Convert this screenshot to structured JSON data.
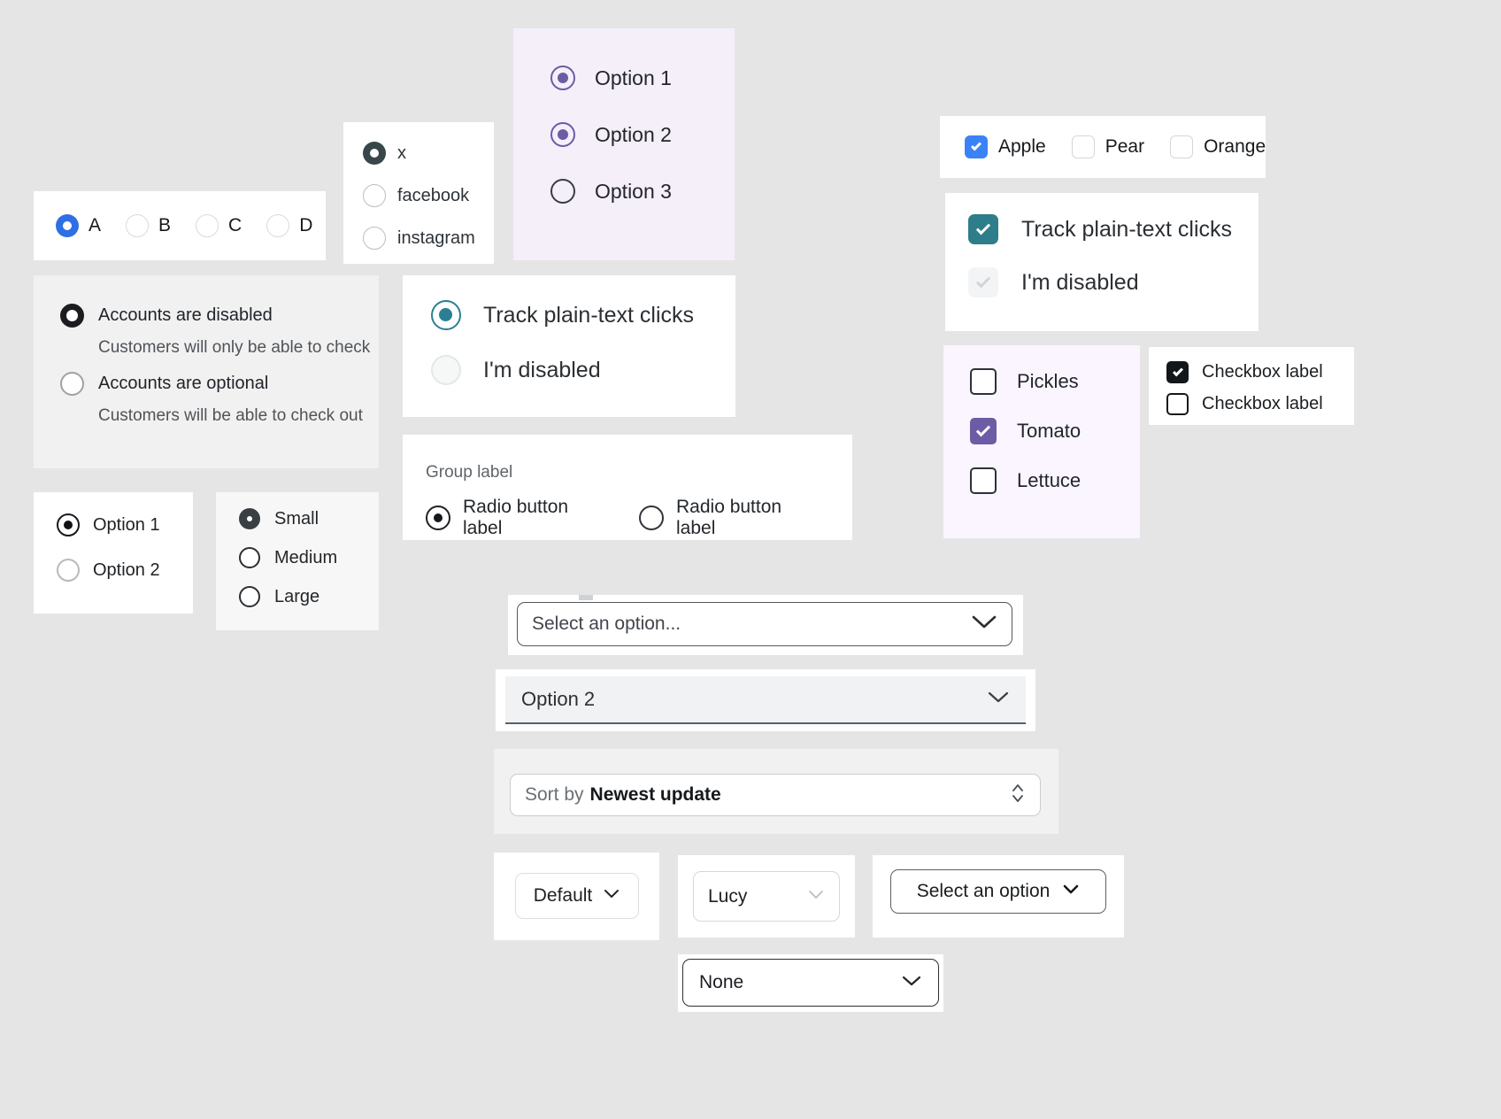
{
  "groups": {
    "abcd": {
      "options": [
        "A",
        "B",
        "C",
        "D"
      ],
      "selected_index": 0,
      "accent": "#2f6fe4"
    },
    "social": {
      "options": [
        "x",
        "facebook",
        "instagram"
      ],
      "selected_index": 0,
      "accent": "#37474a"
    },
    "purple_options": {
      "options": [
        "Option 1",
        "Option 2",
        "Option 3"
      ],
      "selected_indices": [
        0,
        1
      ],
      "accent": "#6b5ca5",
      "background": "#f5effa"
    },
    "accounts": {
      "options": [
        {
          "label": "Accounts are disabled",
          "description": "Customers will only be able to check"
        },
        {
          "label": "Accounts are optional",
          "description": "Customers will be able to check out"
        }
      ],
      "selected_index": 0,
      "background": "#f1f1f1"
    },
    "teal_radios": {
      "options": [
        "Track plain-text clicks",
        "I'm disabled"
      ],
      "selected_index": 0,
      "disabled_index": 1,
      "accent": "#2a7f94"
    },
    "group_label": {
      "legend": "Group label",
      "options": [
        "Radio button label",
        "Radio button label"
      ],
      "selected_index": 0
    },
    "options12": {
      "options": [
        "Option 1",
        "Option 2"
      ],
      "selected_index": 0
    },
    "sizes": {
      "options": [
        "Small",
        "Medium",
        "Large"
      ],
      "selected_index": 0,
      "background": "#f7f7f7"
    }
  },
  "checkboxes": {
    "fruits": {
      "items": [
        {
          "label": "Apple",
          "checked": true
        },
        {
          "label": "Pear",
          "checked": false
        },
        {
          "label": "Orange",
          "checked": false
        }
      ],
      "accent": "#3b82f6"
    },
    "teal": {
      "items": [
        {
          "label": "Track plain-text clicks",
          "checked": true,
          "disabled": false
        },
        {
          "label": "I'm disabled",
          "checked": true,
          "disabled": true
        }
      ],
      "accent": "#2e7d8a"
    },
    "veggies": {
      "items": [
        {
          "label": "Pickles",
          "checked": false
        },
        {
          "label": "Tomato",
          "checked": true
        },
        {
          "label": "Lettuce",
          "checked": false
        }
      ],
      "accent": "#6b5ca5",
      "background": "#faf5fe"
    },
    "labels": {
      "items": [
        {
          "label": "Checkbox label",
          "checked": true
        },
        {
          "label": "Checkbox label",
          "checked": false
        }
      ],
      "accent": "#14171a"
    }
  },
  "selects": {
    "outline": {
      "value": "Select an option...",
      "icon": "chevron-down-icon"
    },
    "filled": {
      "value": "Option 2",
      "icon": "chevron-down-icon"
    },
    "sort": {
      "prefix": "Sort by",
      "value": "Newest update",
      "icon": "chevron-up-down-icon"
    },
    "default": {
      "value": "Default",
      "icon": "chevron-down-icon"
    },
    "lucy": {
      "value": "Lucy",
      "icon": "chevron-down-icon"
    },
    "select_option": {
      "value": "Select an option",
      "icon": "chevron-down-icon"
    },
    "none": {
      "value": "None",
      "icon": "chevron-down-icon"
    }
  }
}
